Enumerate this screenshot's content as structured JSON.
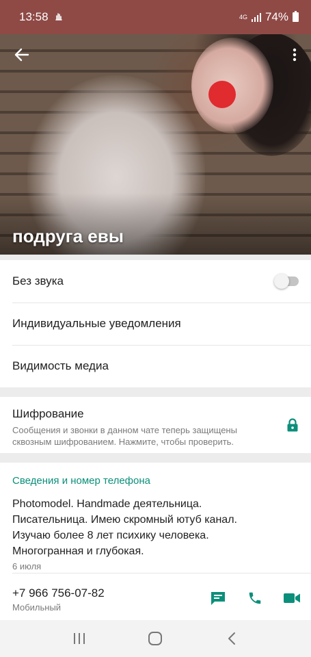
{
  "status_bar": {
    "time": "13:58",
    "network_type": "4G",
    "battery": "74%"
  },
  "header": {
    "contact_name": "подруга евы",
    "icons": [
      "back-arrow-icon",
      "more-vert-icon"
    ]
  },
  "settings": {
    "mute_label": "Без звука",
    "mute_on": false,
    "custom_notifications_label": "Индивидуальные уведомления",
    "media_visibility_label": "Видимость медиа"
  },
  "encryption": {
    "title": "Шифрование",
    "description": "Сообщения и звонки в данном чате теперь защищены сквозным шифрованием. Нажмите, чтобы проверить."
  },
  "about": {
    "section_title": "Сведения и номер телефона",
    "text": "Photomodel.  Handmade деятельница.\nПисательница. Имею скромный ютуб канал.\nИзучаю более 8 лет психику человека.\nМногогранная и глубокая.",
    "date": "6 июля",
    "phone_number": "+7 966 756-07-82",
    "phone_type": "Мобильный"
  },
  "colors": {
    "accent": "#0b8f7a",
    "status_bar": "#8f4a46"
  }
}
